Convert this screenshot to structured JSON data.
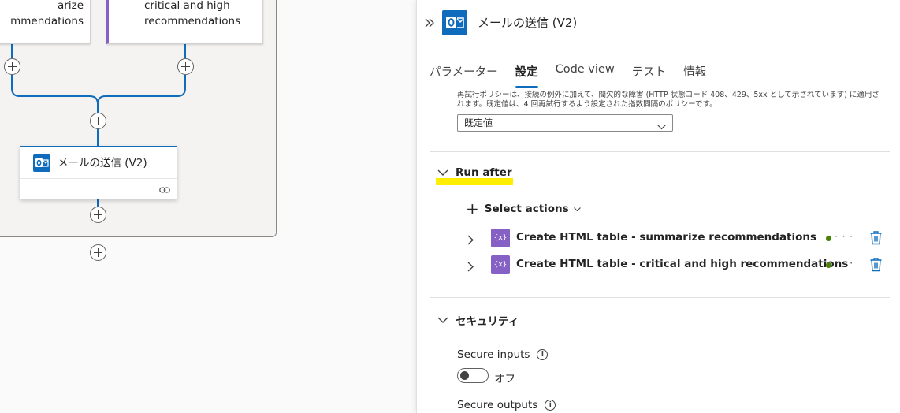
{
  "canvas": {
    "card_a_text": "arize\nmmendations",
    "card_b_text": "critical and high\nrecommendations",
    "card_c_title": "メールの送信 (V2)"
  },
  "panel": {
    "title": "メールの送信 (V2)",
    "tabs": [
      {
        "label": "パラメーター",
        "active": false
      },
      {
        "label": "設定",
        "active": true
      },
      {
        "label": "Code view",
        "active": false
      },
      {
        "label": "テスト",
        "active": false
      },
      {
        "label": "情報",
        "active": false
      }
    ],
    "retry_description": "再試行ポリシーは、接続の例外に加えて、間欠的な障害 (HTTP 状態コード 408、429、5xx として示されています) に適用されます。既定値は、4 回再試行するよう設定された指数間隔のポリシーです。",
    "retry_policy_value": "既定値",
    "run_after": {
      "heading": "Run after",
      "select_actions_label": "Select actions",
      "actions": [
        {
          "label": "Create HTML table - summarize recommendations",
          "badge": "{x}"
        },
        {
          "label": "Create HTML table - critical and high recommendations",
          "badge": "{x}"
        }
      ]
    },
    "security": {
      "heading": "セキュリティ",
      "secure_inputs_label": "Secure inputs",
      "secure_inputs_state": "オフ",
      "secure_outputs_label": "Secure outputs"
    }
  },
  "colors": {
    "accent": "#0f6cbd",
    "variable_action": "#8661c5",
    "highlight": "#ffee00",
    "status_success": "#498205"
  }
}
